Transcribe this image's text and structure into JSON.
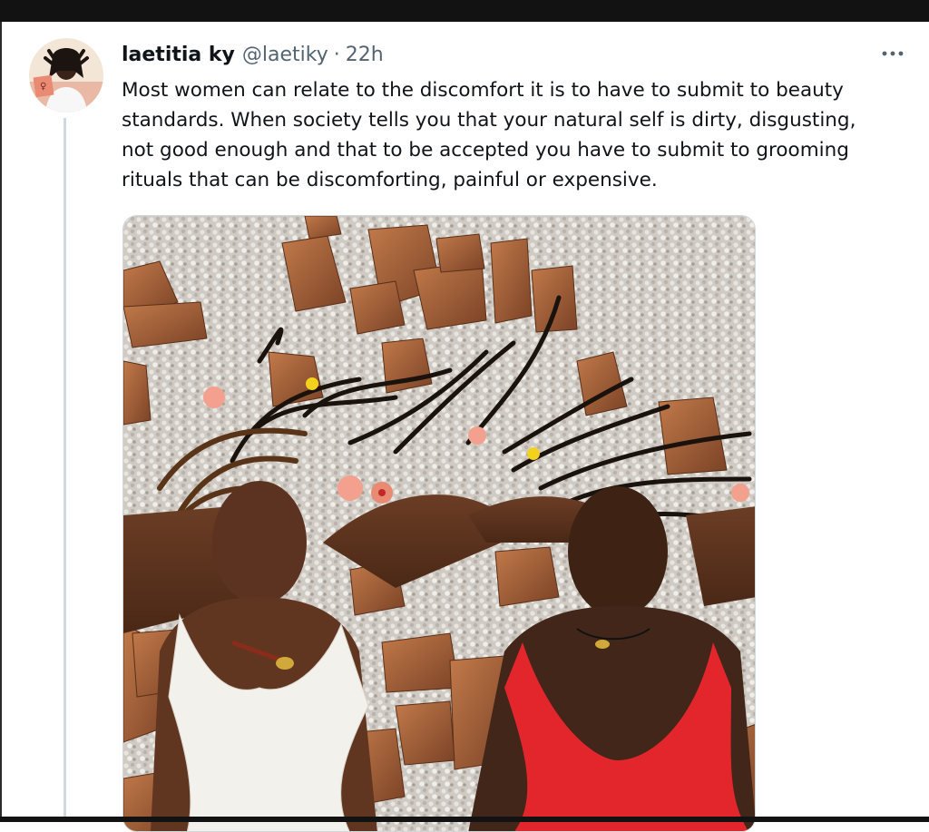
{
  "tweet": {
    "display_name": "laetitia ky",
    "handle": "@laetiky",
    "separator": "·",
    "time": "22h",
    "text_lines": [
      "Most women can relate to the discomfort it is to have to submit to beauty",
      "standards. When society tells you that your natural self is dirty, disgusting,",
      "not good enough and that to be accepted you have to submit to grooming",
      "rituals that can be discomforting, painful or expensive."
    ],
    "more_icon": "more-horizontal-icon",
    "media_description_icon": "photo"
  },
  "colors": {
    "text_primary": "#0f1419",
    "text_secondary": "#536471",
    "thread_line": "#cfd9de",
    "frame": "#121212"
  }
}
